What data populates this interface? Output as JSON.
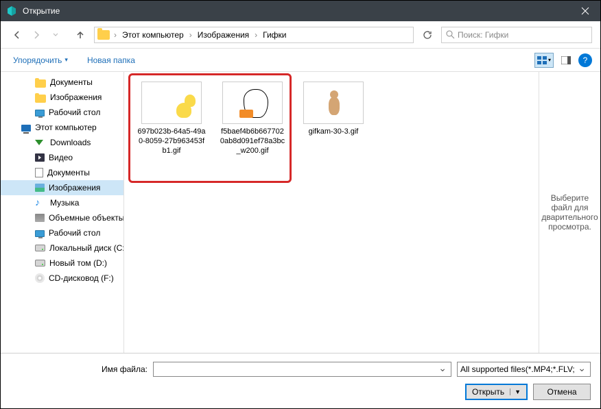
{
  "titlebar": {
    "title": "Открытие"
  },
  "nav": {
    "crumbs": [
      "Этот компьютер",
      "Изображения",
      "Гифки"
    ],
    "search_placeholder": "Поиск: Гифки"
  },
  "toolbar": {
    "organize": "Упорядочить",
    "newfolder": "Новая папка"
  },
  "sidebar": {
    "items": [
      {
        "label": "Документы",
        "icon": "folder",
        "indent": true
      },
      {
        "label": "Изображения",
        "icon": "folder",
        "indent": true
      },
      {
        "label": "Рабочий стол",
        "icon": "desktop",
        "indent": true
      },
      {
        "label": "Этот компьютер",
        "icon": "pc",
        "indent": false
      },
      {
        "label": "Downloads",
        "icon": "dl",
        "indent": true
      },
      {
        "label": "Видео",
        "icon": "video",
        "indent": true
      },
      {
        "label": "Документы",
        "icon": "doc",
        "indent": true
      },
      {
        "label": "Изображения",
        "icon": "pic",
        "indent": true,
        "selected": true
      },
      {
        "label": "Музыка",
        "icon": "music",
        "indent": true
      },
      {
        "label": "Объемные объекты",
        "icon": "vol",
        "indent": true
      },
      {
        "label": "Рабочий стол",
        "icon": "desktop",
        "indent": true
      },
      {
        "label": "Локальный диск (C:)",
        "icon": "drive",
        "indent": true
      },
      {
        "label": "Новый том (D:)",
        "icon": "drive",
        "indent": true
      },
      {
        "label": "CD-дисковод (F:)",
        "icon": "cd",
        "indent": true
      }
    ]
  },
  "files": [
    {
      "name": "697b023b-64a5-49a0-8059-27b963453fb1.gif",
      "thumb": "homer"
    },
    {
      "name": "f5baef4b6b667702 0ab8d091ef78a3bc_w200.gif",
      "thumb": "goose"
    },
    {
      "name": "gifkam-30-3.gif",
      "thumb": "dancer"
    }
  ],
  "preview": {
    "text": "Выберите файл для дварительного просмотра."
  },
  "bottom": {
    "filename_label": "Имя файла:",
    "filename_value": "",
    "filter": "All supported files(*.MP4;*.FLV;",
    "open": "Открыть",
    "cancel": "Отмена"
  }
}
